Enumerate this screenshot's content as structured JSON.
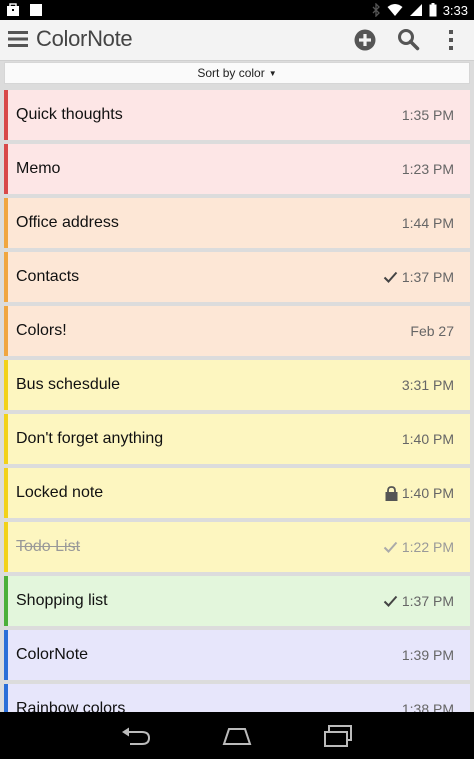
{
  "status_bar": {
    "time": "3:33"
  },
  "app": {
    "title_color": "Color",
    "title_note": "Note"
  },
  "sort": {
    "label": "Sort by color"
  },
  "notes": [
    {
      "title": "Quick thoughts",
      "time": "1:35 PM",
      "mark": "",
      "strike": false,
      "bg": "#fde6e6",
      "accent": "#d84a4a"
    },
    {
      "title": "Memo",
      "time": "1:23 PM",
      "mark": "",
      "strike": false,
      "bg": "#fde6e6",
      "accent": "#d84a4a"
    },
    {
      "title": "Office address",
      "time": "1:44 PM",
      "mark": "",
      "strike": false,
      "bg": "#fde7d6",
      "accent": "#f0a640"
    },
    {
      "title": "Contacts",
      "time": "1:37 PM",
      "mark": "check",
      "strike": false,
      "bg": "#fde7d6",
      "accent": "#f0a640"
    },
    {
      "title": "Colors!",
      "time": "Feb 27",
      "mark": "",
      "strike": false,
      "bg": "#fde7d6",
      "accent": "#f0a640"
    },
    {
      "title": "Bus schesdule",
      "time": "3:31 PM",
      "mark": "",
      "strike": false,
      "bg": "#fdf6c0",
      "accent": "#f2d21a"
    },
    {
      "title": "Don't forget anything",
      "time": "1:40 PM",
      "mark": "",
      "strike": false,
      "bg": "#fdf6c0",
      "accent": "#f2d21a"
    },
    {
      "title": "Locked note",
      "time": "1:40 PM",
      "mark": "lock",
      "strike": false,
      "bg": "#fdf6c0",
      "accent": "#f2d21a"
    },
    {
      "title": "Todo List",
      "time": "1:22 PM",
      "mark": "check-light",
      "strike": true,
      "bg": "#fdf6c0",
      "accent": "#f2d21a"
    },
    {
      "title": "Shopping list",
      "time": "1:37 PM",
      "mark": "check",
      "strike": false,
      "bg": "#e3f6dc",
      "accent": "#4caf3a"
    },
    {
      "title": "ColorNote",
      "time": "1:39 PM",
      "mark": "",
      "strike": false,
      "bg": "#e7e6fb",
      "accent": "#2b6fd8"
    },
    {
      "title": "Rainbow colors",
      "time": "1:38 PM",
      "mark": "",
      "strike": false,
      "bg": "#e7e6fb",
      "accent": "#2b6fd8"
    }
  ],
  "icons": {
    "menu": "menu-icon",
    "add": "add-icon",
    "search": "search-icon",
    "more": "more-vert-icon",
    "back": "back-icon",
    "home": "home-icon",
    "recents": "recents-icon"
  }
}
